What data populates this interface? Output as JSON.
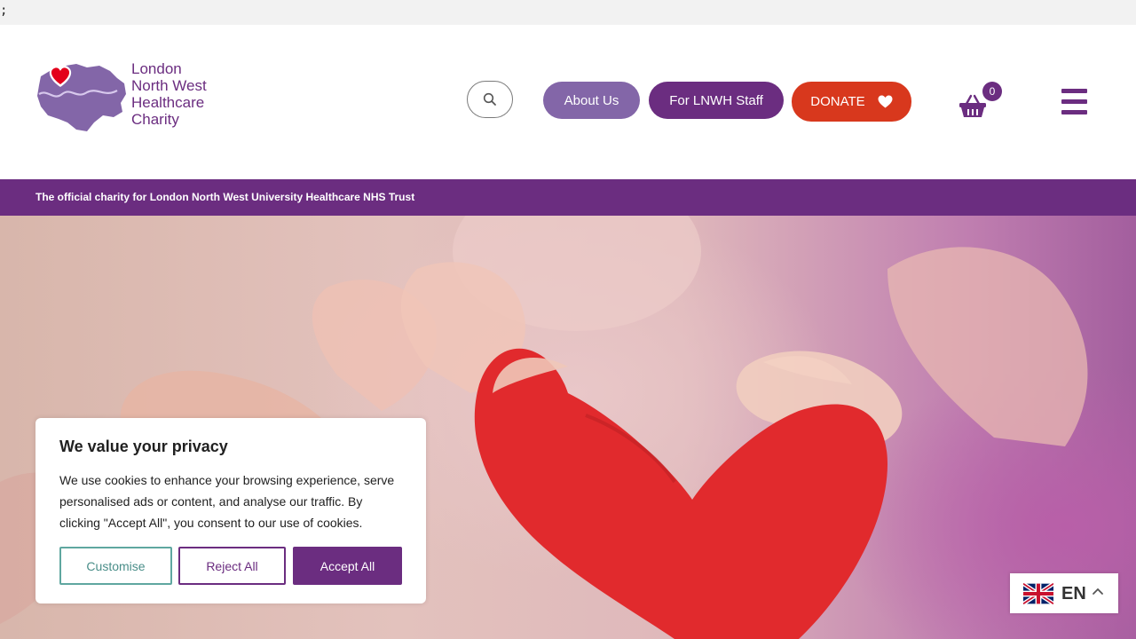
{
  "top_strip": {
    "text": ";"
  },
  "logo": {
    "lines": [
      "London",
      "North West",
      "Healthcare",
      "Charity"
    ],
    "icon": "heart-map-icon"
  },
  "header": {
    "search_icon": "search-icon",
    "about_label": "About Us",
    "staff_label": "For LNWH Staff",
    "donate_label": "DONATE",
    "donate_icon": "heart-icon",
    "basket_icon": "basket-icon",
    "basket_count": "0",
    "menu_icon": "hamburger-icon"
  },
  "tagline": "The official charity for London North West University Healthcare NHS Trust",
  "hero": {
    "image": "hands-holding-red-knitted-heart"
  },
  "cookie_banner": {
    "title": "We value your privacy",
    "body": "We use cookies to enhance your browsing experience, serve personalised ads or content, and analyse our traffic. By clicking \"Accept All\", you consent to our use of cookies.",
    "customise_label": "Customise",
    "reject_label": "Reject All",
    "accept_label": "Accept All"
  },
  "language": {
    "code": "EN",
    "flag": "uk-flag-icon"
  },
  "colors": {
    "brand_purple": "#6b2d80",
    "light_purple": "#8366a8",
    "donate_red": "#d8381d",
    "customise_teal": "#5fa7a0"
  }
}
